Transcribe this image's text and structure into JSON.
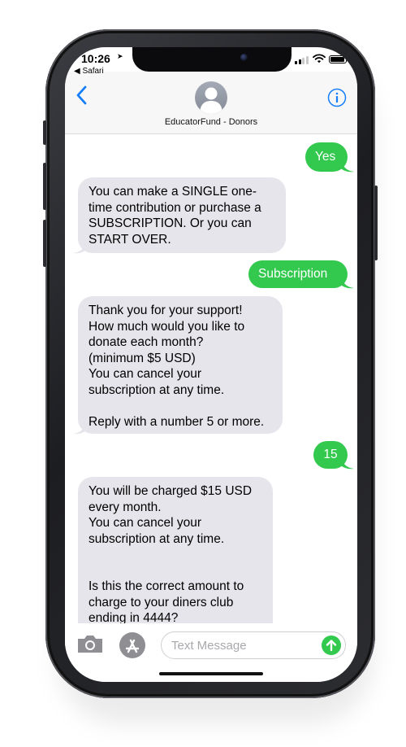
{
  "status_bar": {
    "time": "10:26",
    "location_icon": "location-arrow-icon",
    "back_to_app": "◀ Safari",
    "signal_icon": "cellular-signal-icon",
    "wifi_icon": "wifi-icon",
    "battery_icon": "battery-icon"
  },
  "header": {
    "back_icon": "chevron-left-icon",
    "avatar_icon": "person-silhouette-icon",
    "contact_name": "EducatorFund - Donors",
    "info_icon": "info-icon",
    "accent_color": "#147efb"
  },
  "messages": [
    {
      "direction": "outgoing",
      "text": "Yes"
    },
    {
      "direction": "incoming",
      "text": "You can make a SINGLE one-\ntime contribution or purchase a\nSUBSCRIPTION.  Or you can\nSTART OVER."
    },
    {
      "direction": "outgoing",
      "text": "Subscription"
    },
    {
      "direction": "incoming",
      "text": "Thank you for your support!\nHow much would you like to\ndonate each month?\n(minimum $5 USD)\nYou can cancel your\nsubscription at any time.\n\nReply with a number 5 or more."
    },
    {
      "direction": "outgoing",
      "text": "15"
    },
    {
      "direction": "incoming",
      "text": "You will be charged $15 USD\nevery month.\nYou can cancel your\nsubscription at any time.\n\n\nIs this the correct amount to\ncharge to your diners club\nending in 4444?"
    }
  ],
  "bubble_colors": {
    "incoming": "#e6e5eb",
    "outgoing": "#32c94e"
  },
  "compose": {
    "camera_icon": "camera-icon",
    "apps_icon": "app-store-icon",
    "placeholder": "Text Message",
    "send_icon": "send-arrow-up-icon"
  }
}
